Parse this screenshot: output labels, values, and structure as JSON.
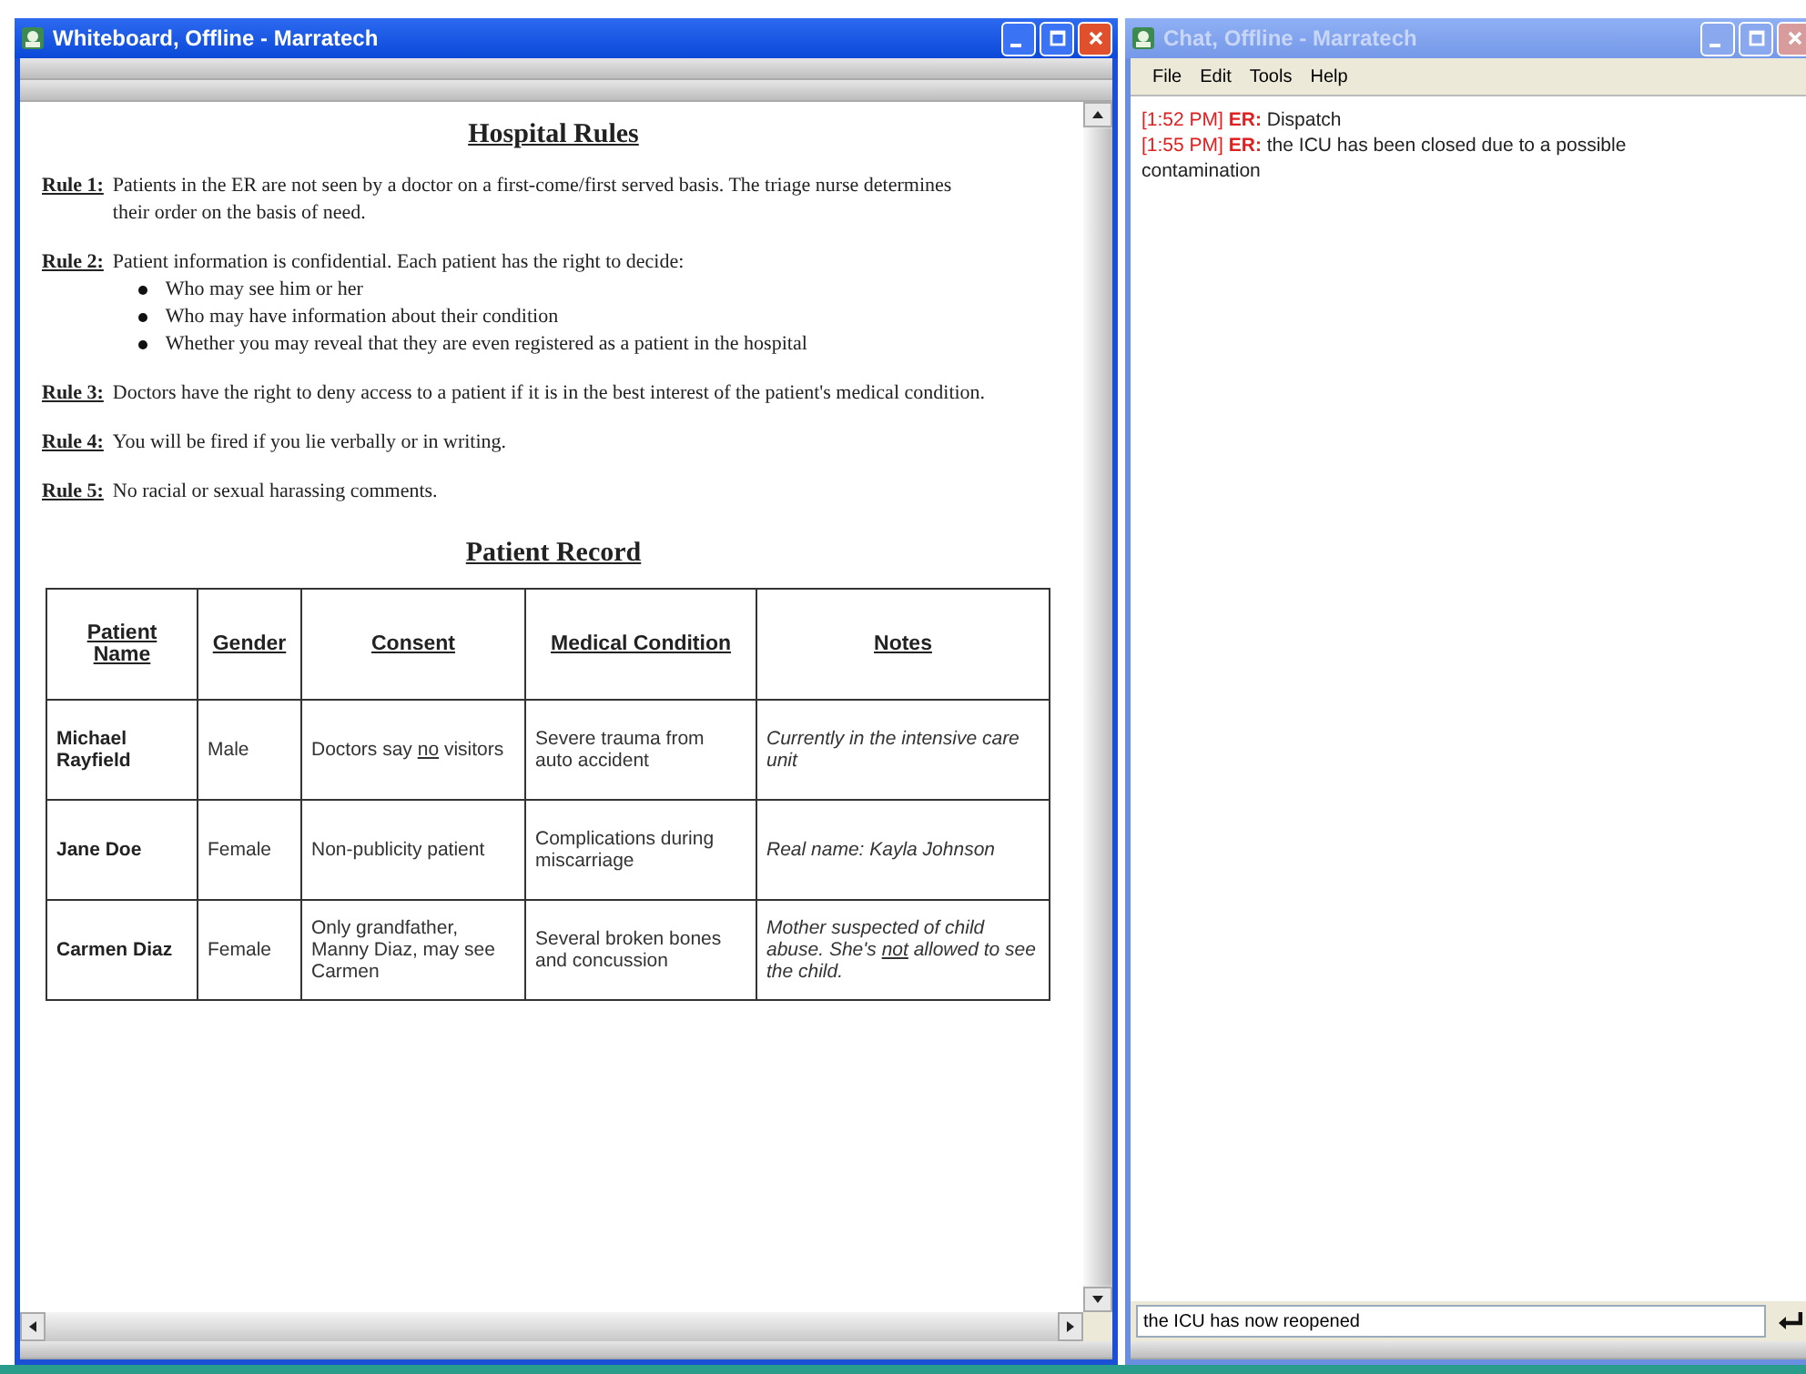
{
  "whiteboard": {
    "title": "Whiteboard, Offline - Marratech",
    "active": true,
    "heading": "Hospital Rules",
    "rules": [
      {
        "label": "Rule 1:",
        "text": "Patients in the ER are not seen by a doctor on a first-come/first served basis. The triage nurse determines their order on the basis of need."
      },
      {
        "label": "Rule 2:",
        "text": "Patient information is confidential. Each patient has the right to decide:",
        "bullets": [
          "Who may see him or her",
          "Who may have information about their condition",
          "Whether you may reveal that they are even registered as a patient in the hospital"
        ]
      },
      {
        "label": "Rule 3:",
        "text": "Doctors have the right to deny access to a patient if it is in the best interest of the patient's medical condition."
      },
      {
        "label": "Rule 4:",
        "text": "You will be fired if you lie verbally or in writing."
      },
      {
        "label": "Rule 5:",
        "text": "No racial or sexual harassing comments."
      }
    ],
    "table_title": "Patient Record",
    "table": {
      "columns": [
        "Patient Name",
        "Gender",
        "Consent",
        "Medical Condition",
        "Notes"
      ],
      "rows": [
        [
          "Michael Rayfield",
          "Male",
          [
            {
              "text": "Doctors say ",
              "underline": false
            },
            {
              "text": "no",
              "underline": true
            },
            {
              "text": " visitors",
              "underline": false
            }
          ],
          "Severe trauma from auto accident",
          "Currently in the intensive care unit"
        ],
        [
          "Jane Doe",
          "Female",
          "Non-publicity patient",
          "Complications during miscarriage",
          "Real name: Kayla Johnson"
        ],
        [
          "Carmen Diaz",
          "Female",
          "Only grandfather, Manny Diaz, may see Carmen",
          "Several broken bones and concussion",
          [
            {
              "text": "Mother suspected of child abuse.  She's ",
              "underline": false
            },
            {
              "text": "not",
              "underline": true
            },
            {
              "text": " allowed to see the child.",
              "underline": false
            }
          ]
        ]
      ]
    }
  },
  "chat": {
    "title": "Chat, Offline - Marratech",
    "active": false,
    "menu": [
      "File",
      "Edit",
      "Tools",
      "Help"
    ],
    "messages": [
      {
        "time": "[1:52 PM]",
        "sender": "ER:",
        "text": "Dispatch"
      },
      {
        "time": "[1:55 PM]",
        "sender": "ER:",
        "text": "the ICU has been closed due to a possible contamination"
      }
    ],
    "input": {
      "value": "the ICU has now reopened"
    }
  }
}
